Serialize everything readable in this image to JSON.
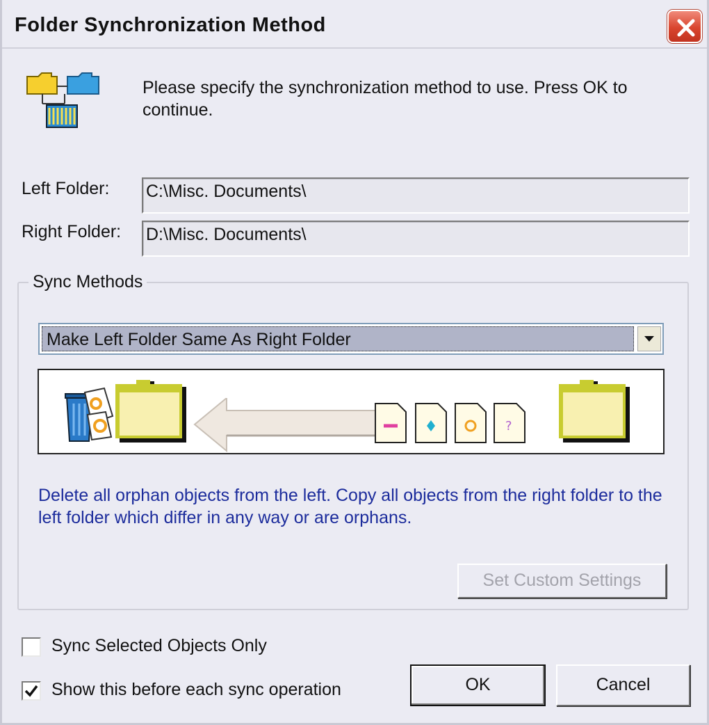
{
  "window": {
    "title": "Folder Synchronization Method",
    "close_icon": "close-icon"
  },
  "header": {
    "icon": "folder-sync-icon",
    "prompt": "Please specify the synchronization method to use.  Press OK to continue."
  },
  "folders": {
    "left_label": "Left Folder:",
    "left_path": "C:\\Misc. Documents\\",
    "right_label": "Right Folder:",
    "right_path": "D:\\Misc. Documents\\"
  },
  "sync_methods": {
    "legend": "Sync Methods",
    "selected": "Make Left Folder Same As Right Folder",
    "description": "Delete all orphan objects from the left. Copy all objects from the right folder to the left folder which differ in any way or are orphans.",
    "custom_settings_label": "Set Custom Settings",
    "custom_settings_enabled": false,
    "preview_icons": [
      "recycle-bin-icon",
      "folder-icon",
      "arrow-left-icon",
      "file-icon",
      "folder-icon"
    ]
  },
  "options": {
    "sync_selected_label": "Sync Selected Objects Only",
    "sync_selected_checked": false,
    "show_before_label": "Show this before each sync operation",
    "show_before_checked": true
  },
  "buttons": {
    "ok": "OK",
    "cancel": "Cancel"
  },
  "colors": {
    "description_text": "#1c2c9c",
    "close_button": "#d9452e",
    "selection_highlight": "#b0b4c8",
    "disabled_text": "#a3a3ab"
  }
}
